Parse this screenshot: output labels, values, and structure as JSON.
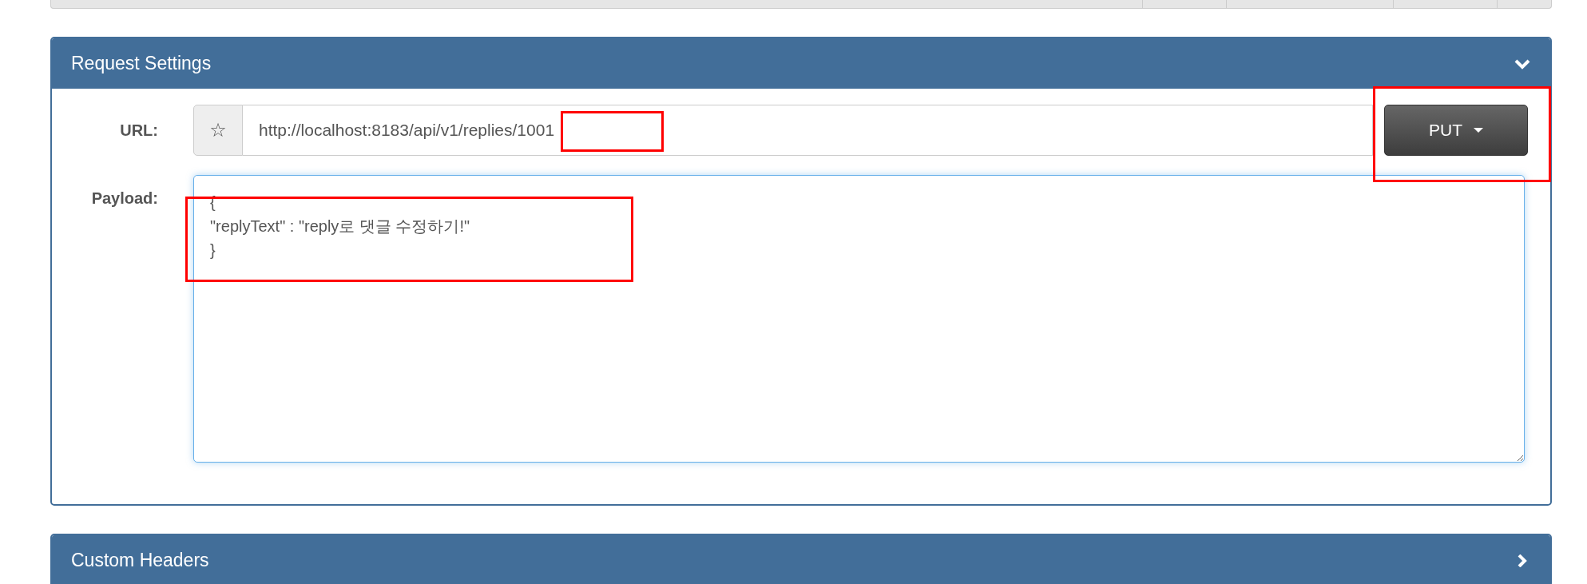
{
  "panels": [
    {
      "title": "Request Settings",
      "expanded": true,
      "url": {
        "label": "URL:",
        "value": "http://localhost:8183/api/v1/replies/1001",
        "favorite_icon": "☆"
      },
      "method": {
        "label": "PUT"
      },
      "payload": {
        "label": "Payload:",
        "value": "{\n\"replyText\" : \"reply로 댓글 수정하기!\"\n}"
      }
    },
    {
      "title": "Custom Headers",
      "expanded": false
    }
  ],
  "annotations": [
    {
      "kind": "highlight"
    },
    {
      "kind": "highlight"
    },
    {
      "kind": "highlight"
    }
  ]
}
